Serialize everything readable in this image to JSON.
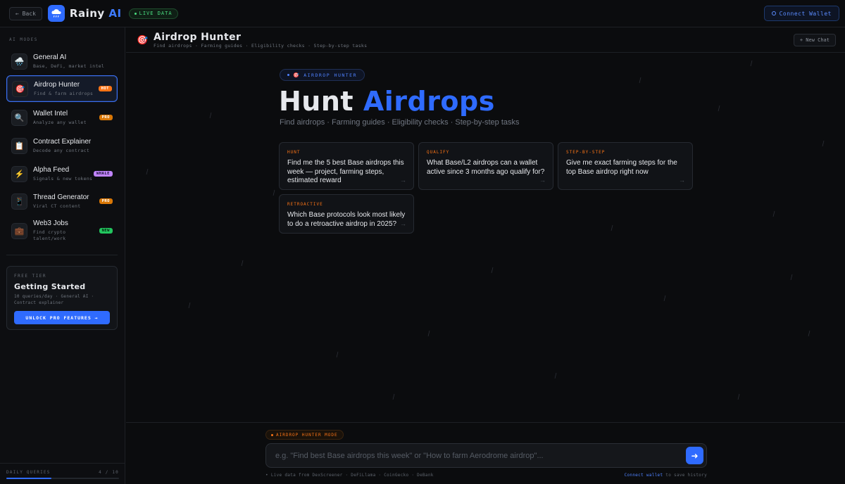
{
  "header": {
    "back_label": "← Back",
    "brand_name": "Rainy",
    "brand_suffix": "AI",
    "live_label": "LIVE DATA",
    "connect_label": "Connect Wallet"
  },
  "sidebar": {
    "heading": "AI MODES",
    "modes": [
      {
        "icon": "🌧️",
        "name": "General AI",
        "desc": "Base, DeFi, market intel",
        "badge": ""
      },
      {
        "icon": "🎯",
        "name": "Airdrop Hunter",
        "desc": "Find & farm airdrops",
        "badge": "HOT"
      },
      {
        "icon": "🔍",
        "name": "Wallet Intel",
        "desc": "Analyze any wallet",
        "badge": "PRO"
      },
      {
        "icon": "📋",
        "name": "Contract Explainer",
        "desc": "Decode any contract",
        "badge": ""
      },
      {
        "icon": "⚡",
        "name": "Alpha Feed",
        "desc": "Signals & new tokens",
        "badge": "WHALE"
      },
      {
        "icon": "📱",
        "name": "Thread Generator",
        "desc": "Viral CT content",
        "badge": "PRO"
      },
      {
        "icon": "💼",
        "name": "Web3 Jobs",
        "desc": "Find crypto talent/work",
        "badge": "NEW"
      }
    ],
    "free_tier": {
      "tag": "FREE TIER",
      "title": "Getting Started",
      "desc": "10 queries/day · General AI · Contract explainer",
      "button": "UNLOCK PRO FEATURES →"
    },
    "queries": {
      "label": "DAILY QUERIES",
      "used": 4,
      "total": 10,
      "count_text": "4 / 10"
    }
  },
  "main": {
    "icon": "🎯",
    "title": "Airdrop Hunter",
    "subtitle": "Find airdrops · Farming guides · Eligibility checks · Step-by-step tasks",
    "new_chat": "+ New Chat",
    "mode_pill": "AIRDROP HUNTER",
    "hero_white": "Hunt",
    "hero_blue": "Airdrops",
    "hero_sub": "Find airdrops · Farming guides · Eligibility checks · Step-by-step tasks",
    "cards": [
      {
        "tag": "HUNT",
        "text": "Find me the 5 best Base airdrops this week — project, farming steps, estimated reward"
      },
      {
        "tag": "QUALIFY",
        "text": "What Base/L2 airdrops can a wallet active since 3 months ago qualify for?"
      },
      {
        "tag": "STEP-BY-STEP",
        "text": "Give me exact farming steps for the top Base airdrop right now"
      },
      {
        "tag": "RETROACTIVE",
        "text": "Which Base protocols look most likely to do a retroactive airdrop in 2025?"
      }
    ]
  },
  "composer": {
    "mode_label": "AIRDROP HUNTER MODE",
    "placeholder": "e.g. \"Find best Base airdrops this week\" or \"How to farm Aerodrome airdrop\"...",
    "sources": "• Live data from DexScreener · DeFiLlama · CoinGecko · DeBank",
    "save_link": "Connect wallet",
    "save_rest": " to save history"
  },
  "colors": {
    "accent": "#2f6bff",
    "hot": "#f97316",
    "live": "#4ade80",
    "background": "#0b0c0e"
  }
}
